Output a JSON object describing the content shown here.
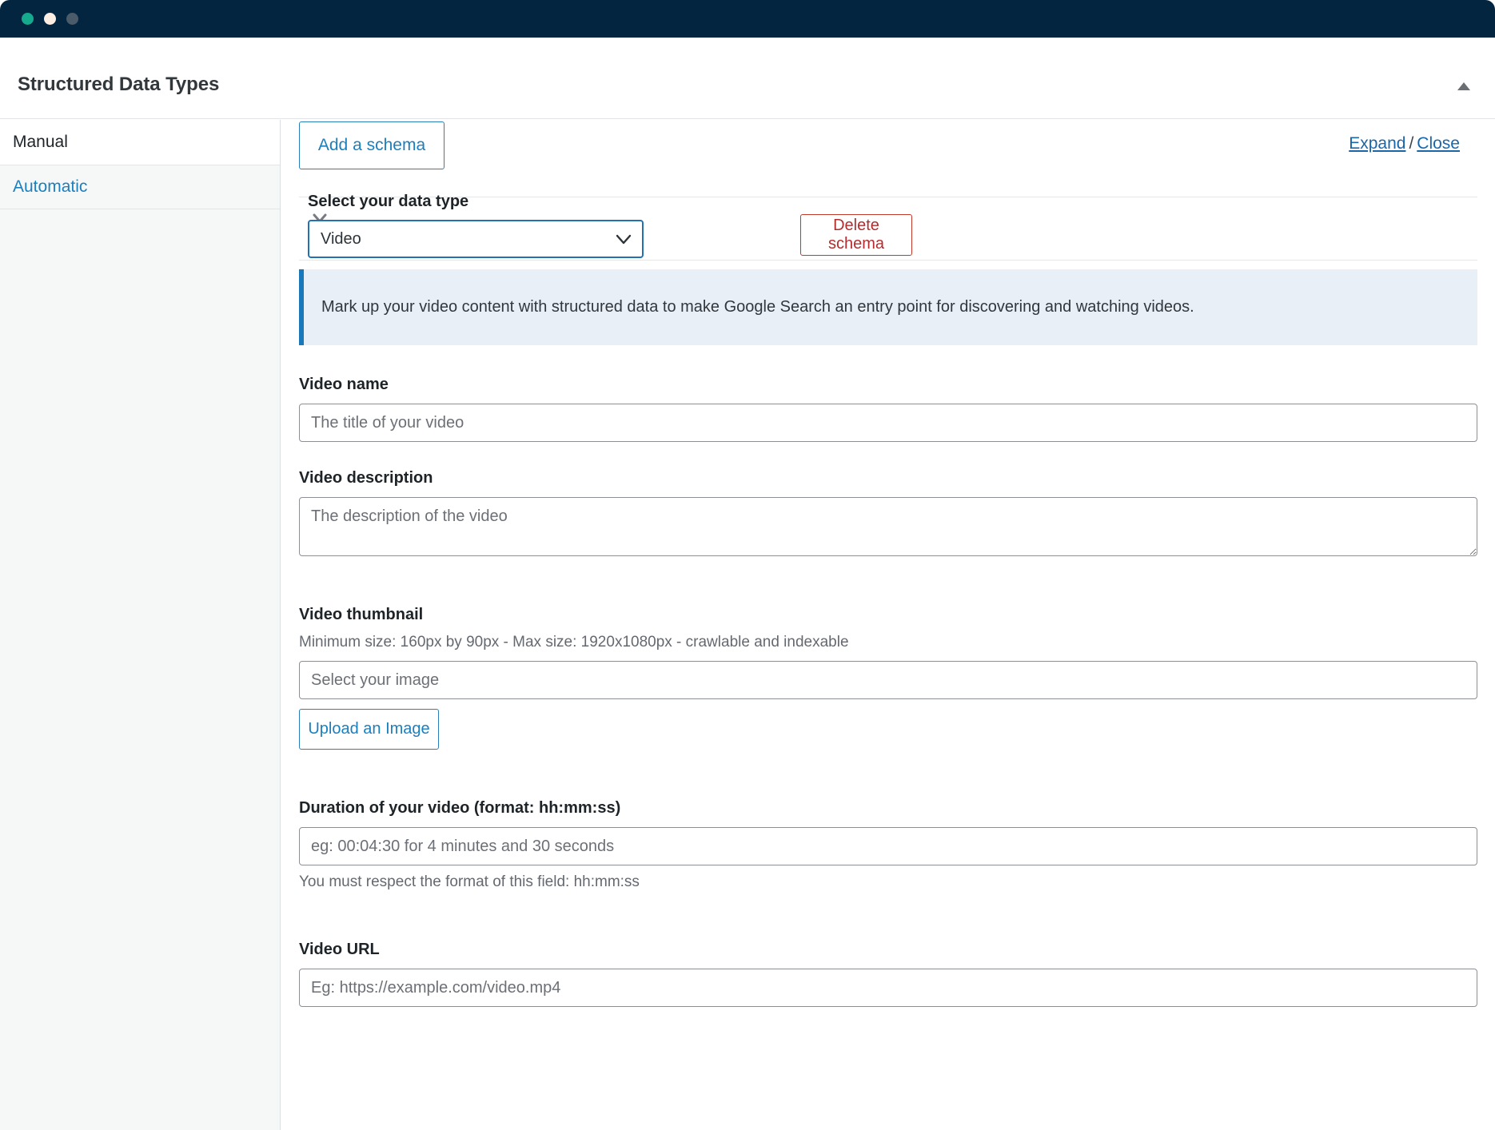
{
  "window": {
    "dots": [
      "close-dot",
      "minimize-dot",
      "maximize-dot"
    ],
    "colors": {
      "titlebar": "#04253f",
      "dot_green": "#15a98e",
      "dot_amber": "#fdeee4",
      "dot_grey": "#4b5b69",
      "link_blue": "#1b7fbd",
      "danger_red": "#b32d2e",
      "banner_bg": "#e9eff7",
      "banner_accent": "#1878ba"
    }
  },
  "header": {
    "title": "Structured Data Types",
    "collapse_icon": "triangle-up-icon"
  },
  "sidebar": {
    "items": [
      {
        "label": "Manual",
        "active": true
      },
      {
        "label": "Automatic",
        "active": false
      }
    ]
  },
  "toolbar": {
    "add_schema_label": "Add a schema",
    "expand_label": "Expand",
    "separator": "/",
    "close_label": "Close"
  },
  "schema": {
    "collapse_icon": "chevron-down-icon",
    "data_type_label": "Select your data type",
    "data_type_value": "Video",
    "data_type_options": [
      "Video"
    ],
    "delete_label": "Delete schema",
    "banner_text": "Mark up your video content with structured data to make Google Search an entry point for discovering and watching videos."
  },
  "fields": {
    "video_name": {
      "label": "Video name",
      "placeholder": "The title of your video",
      "value": ""
    },
    "video_description": {
      "label": "Video description",
      "placeholder": "The description of the video",
      "value": ""
    },
    "video_thumbnail": {
      "label": "Video thumbnail",
      "hint": "Minimum size: 160px by 90px - Max size: 1920x1080px - crawlable and indexable",
      "placeholder": "Select your image",
      "value": "",
      "upload_label": "Upload an Image"
    },
    "video_duration": {
      "label": "Duration of your video (format: hh:mm:ss)",
      "placeholder": "eg: 00:04:30 for 4 minutes and 30 seconds",
      "value": "",
      "hint_below": "You must respect the format of this field: hh:mm:ss"
    },
    "video_url": {
      "label": "Video URL",
      "placeholder": "Eg: https://example.com/video.mp4",
      "value": ""
    }
  }
}
